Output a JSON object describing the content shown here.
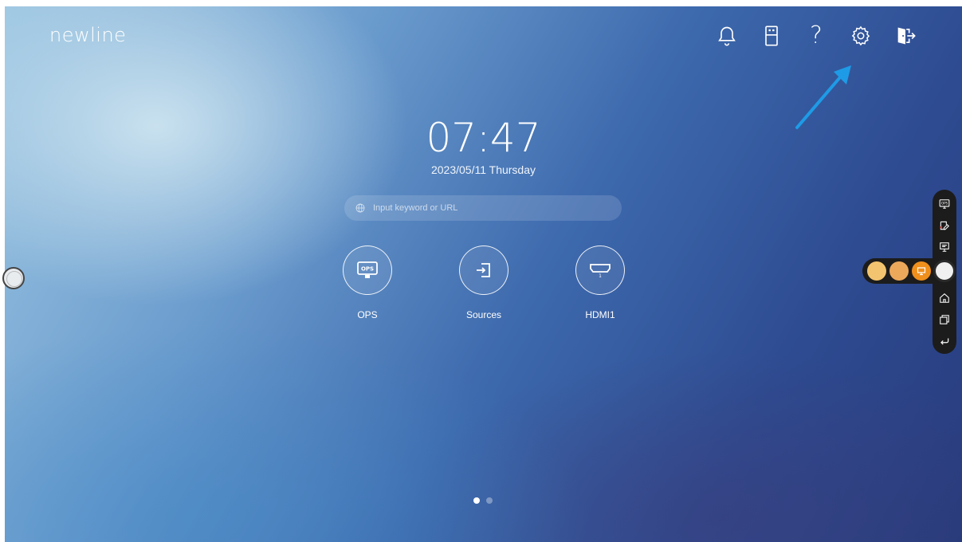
{
  "brand": {
    "logo_text": "newline"
  },
  "top_bar": {
    "icons": [
      "bell-icon",
      "usb-drive-icon",
      "help-icon",
      "settings-gear-icon",
      "exit-icon"
    ],
    "help_glyph": "?"
  },
  "clock": {
    "time": "07:47",
    "date": "2023/05/11  Thursday"
  },
  "search": {
    "placeholder": "Input keyword or URL",
    "value": ""
  },
  "apps": [
    {
      "label": "OPS",
      "icon": "ops-monitor-icon",
      "glyph": "OPS"
    },
    {
      "label": "Sources",
      "icon": "source-input-icon"
    },
    {
      "label": "HDMI1",
      "icon": "hdmi-port-icon",
      "glyph": "1"
    }
  ],
  "pagination": {
    "pages": 2,
    "current": 1
  },
  "side_toolbar": {
    "items": [
      "ops-icon",
      "annotate-icon",
      "whiteboard-icon",
      "home-icon",
      "multitask-icon",
      "back-icon"
    ],
    "ops_glyph": "OPS"
  },
  "quick_bar": {
    "buttons": [
      "quick-app-1",
      "quick-app-2",
      "whiteboard-quick-icon"
    ]
  },
  "colors": {
    "accent_arrow": "#1e9be6",
    "quick_1": "#f3c46f",
    "quick_2": "#eca85a",
    "quick_3": "#ef8f1c",
    "dot_active": "#ffffff",
    "dot_inactive": "rgba(255,255,255,0.35)"
  }
}
